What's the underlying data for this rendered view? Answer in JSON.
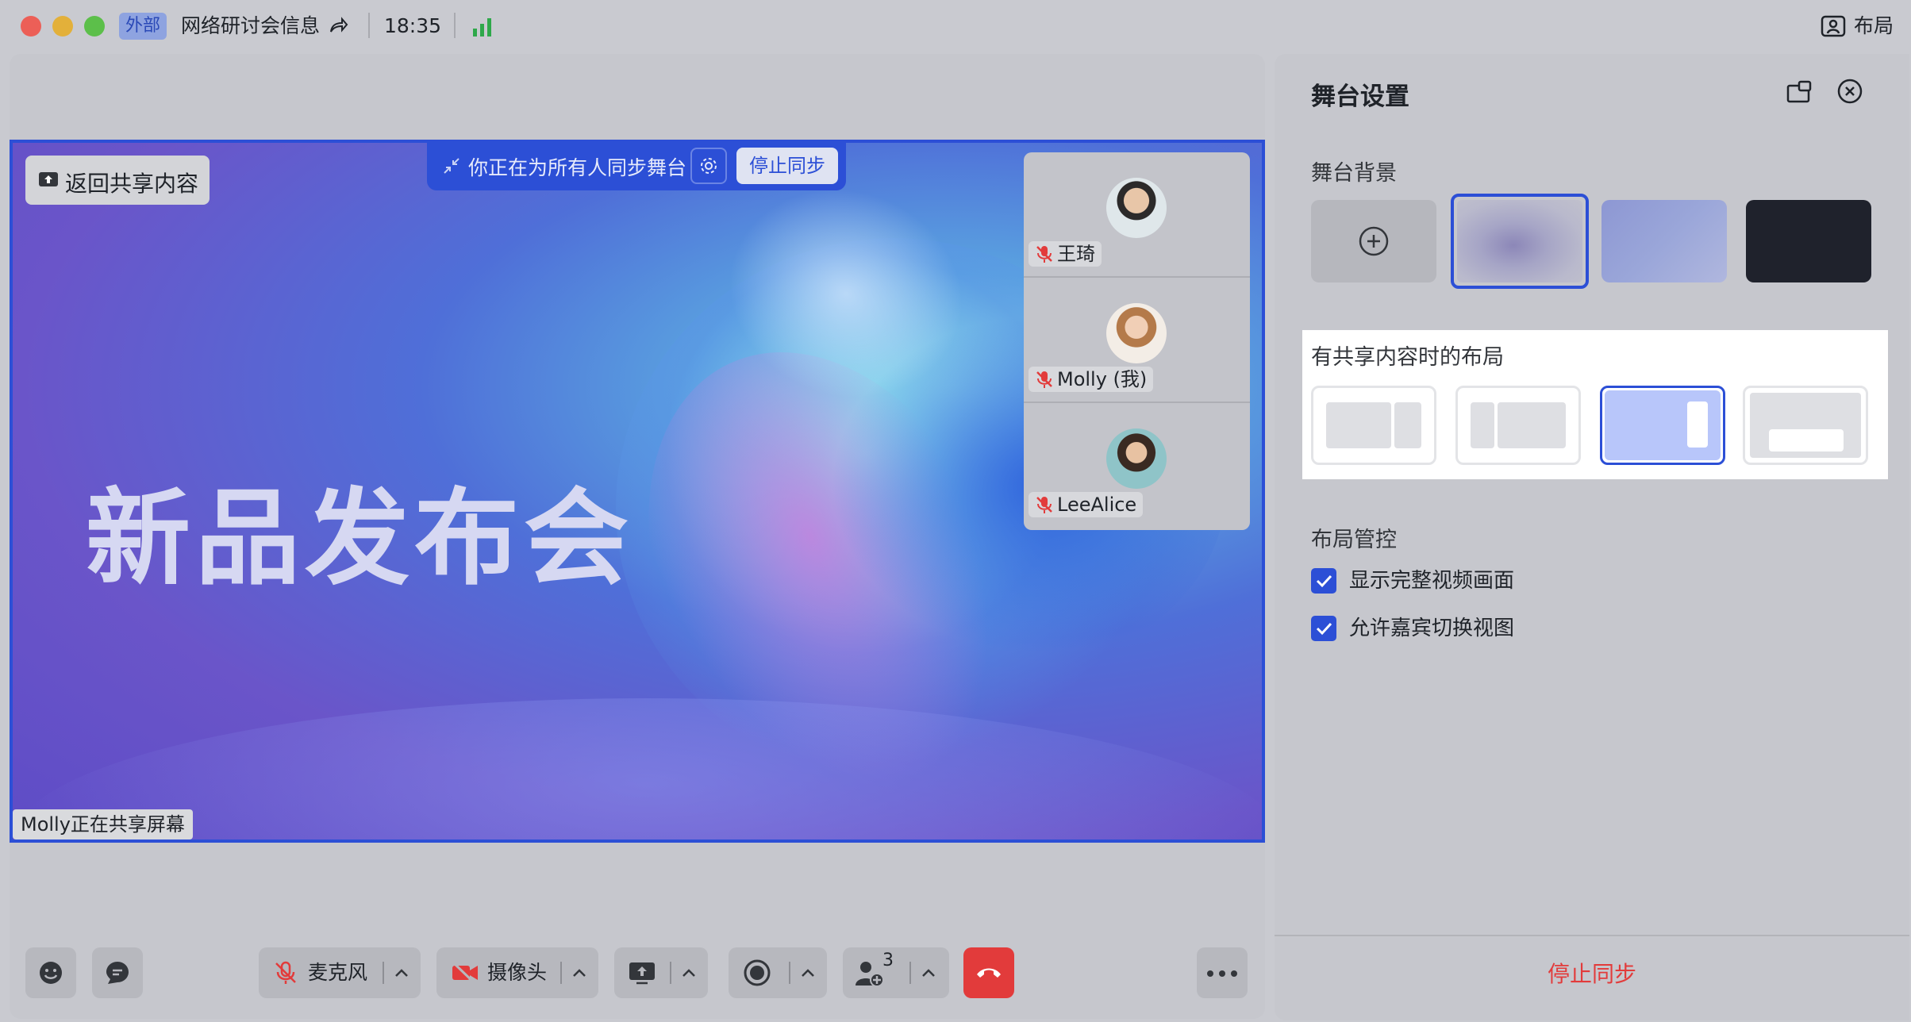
{
  "titlebar": {
    "tag": "外部",
    "meeting_title": "网络研讨会信息",
    "time": "18:35",
    "layout_label": "布局"
  },
  "stage": {
    "back_button": "返回共享内容",
    "sync_text": "你正在为所有人同步舞台",
    "stop_sync_button": "停止同步",
    "slide_title": "新品发布会",
    "sharing_label": "Molly正在共享屏幕",
    "participants": [
      {
        "name": "王琦",
        "muted": true
      },
      {
        "name": "Molly (我)",
        "muted": true
      },
      {
        "name": "LeeAlice",
        "muted": true
      }
    ]
  },
  "toolbar": {
    "mic_label": "麦克风",
    "camera_label": "摄像头",
    "participant_count": "3"
  },
  "panel": {
    "title": "舞台设置",
    "background_section": "舞台背景",
    "layout_section": "有共享内容时的布局",
    "control_section": "布局管控",
    "checkbox_1": "显示完整视频画面",
    "checkbox_2": "允许嘉宾切换视图",
    "stop_sync": "停止同步"
  },
  "colors": {
    "accent": "#2c4fd6",
    "danger": "#e23b3b",
    "signal": "#2ea84a"
  }
}
